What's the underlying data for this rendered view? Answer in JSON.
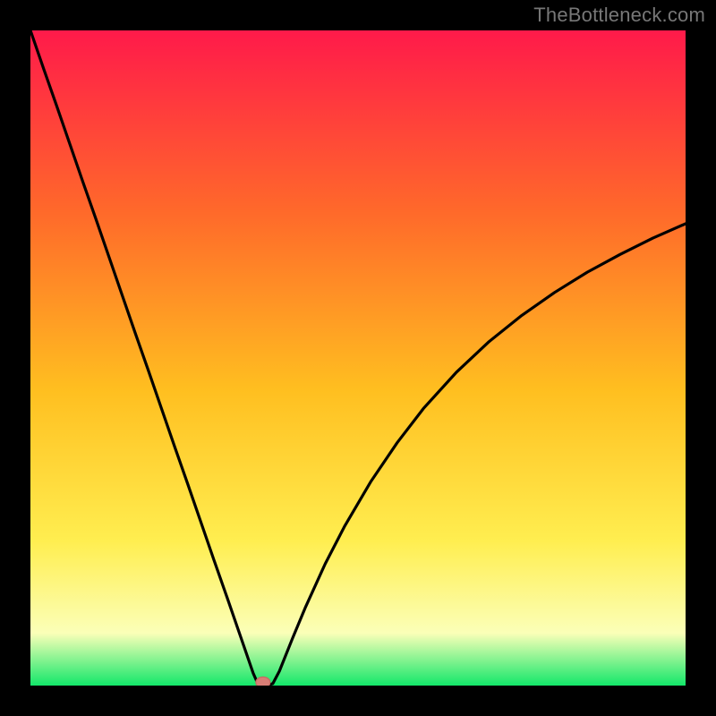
{
  "watermark": "TheBottleneck.com",
  "colors": {
    "frame": "#000000",
    "gradient_top": "#ff1a4a",
    "gradient_upper_mid": "#ff6a2a",
    "gradient_mid": "#ffbf20",
    "gradient_lower_mid": "#ffee50",
    "gradient_lower": "#fbffb8",
    "gradient_bottom": "#13e76a",
    "curve": "#000000",
    "marker_fill": "#d77d75",
    "marker_stroke": "#c46a62"
  },
  "chart_data": {
    "type": "line",
    "title": "",
    "xlabel": "",
    "ylabel": "",
    "xlim": [
      0,
      100
    ],
    "ylim": [
      0,
      100
    ],
    "grid": false,
    "legend": false,
    "annotations": [],
    "series": [
      {
        "name": "bottleneck-curve",
        "x": [
          0,
          2,
          4,
          6,
          8,
          10,
          12,
          14,
          16,
          18,
          20,
          22,
          24,
          26,
          28,
          30,
          32,
          33,
          34,
          34.7,
          35.3,
          36,
          37,
          38,
          40,
          42,
          45,
          48,
          52,
          56,
          60,
          65,
          70,
          75,
          80,
          85,
          90,
          95,
          100
        ],
        "y": [
          100,
          94.2,
          88.5,
          82.7,
          76.9,
          71.2,
          65.4,
          59.6,
          53.8,
          48.1,
          42.3,
          36.5,
          30.8,
          25.0,
          19.2,
          13.5,
          7.7,
          4.8,
          1.9,
          0.3,
          0.0,
          0.0,
          0.3,
          2.2,
          7.2,
          12.0,
          18.6,
          24.4,
          31.2,
          37.1,
          42.3,
          47.8,
          52.5,
          56.5,
          60.0,
          63.1,
          65.8,
          68.3,
          70.5
        ]
      }
    ],
    "marker": {
      "x": 35.5,
      "y": 0.5
    }
  }
}
